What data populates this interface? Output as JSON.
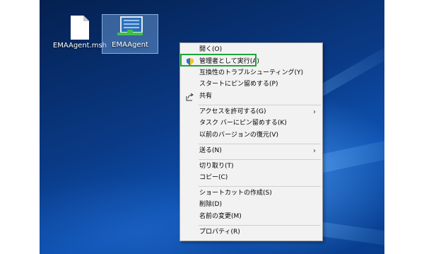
{
  "desktop": {
    "icons": [
      {
        "label": "EMAAgent.msh",
        "icon": "document-icon"
      },
      {
        "label": "EMAAgent",
        "icon": "network-drive-icon",
        "selected": true
      }
    ]
  },
  "context_menu": {
    "items": [
      {
        "label": "開く(O)"
      },
      {
        "label": "管理者として実行(A)",
        "icon": "uac-shield-icon",
        "highlighted": true
      },
      {
        "label": "互換性のトラブルシューティング(Y)"
      },
      {
        "label": "スタートにピン留めする(P)"
      },
      {
        "label": "共有",
        "icon": "share-icon"
      },
      {
        "label": "アクセスを許可する(G)",
        "submenu": true
      },
      {
        "label": "タスク バーにピン留めする(K)"
      },
      {
        "label": "以前のバージョンの復元(V)"
      },
      {
        "label": "送る(N)",
        "submenu": true
      },
      {
        "label": "切り取り(T)"
      },
      {
        "label": "コピー(C)"
      },
      {
        "label": "ショートカットの作成(S)"
      },
      {
        "label": "削除(D)"
      },
      {
        "label": "名前の変更(M)"
      },
      {
        "label": "プロパティ(R)"
      }
    ]
  },
  "colors": {
    "highlight_border": "#1ba63a",
    "menu_background": "#f2f2f2",
    "desktop_blue": "#0a3a86"
  }
}
